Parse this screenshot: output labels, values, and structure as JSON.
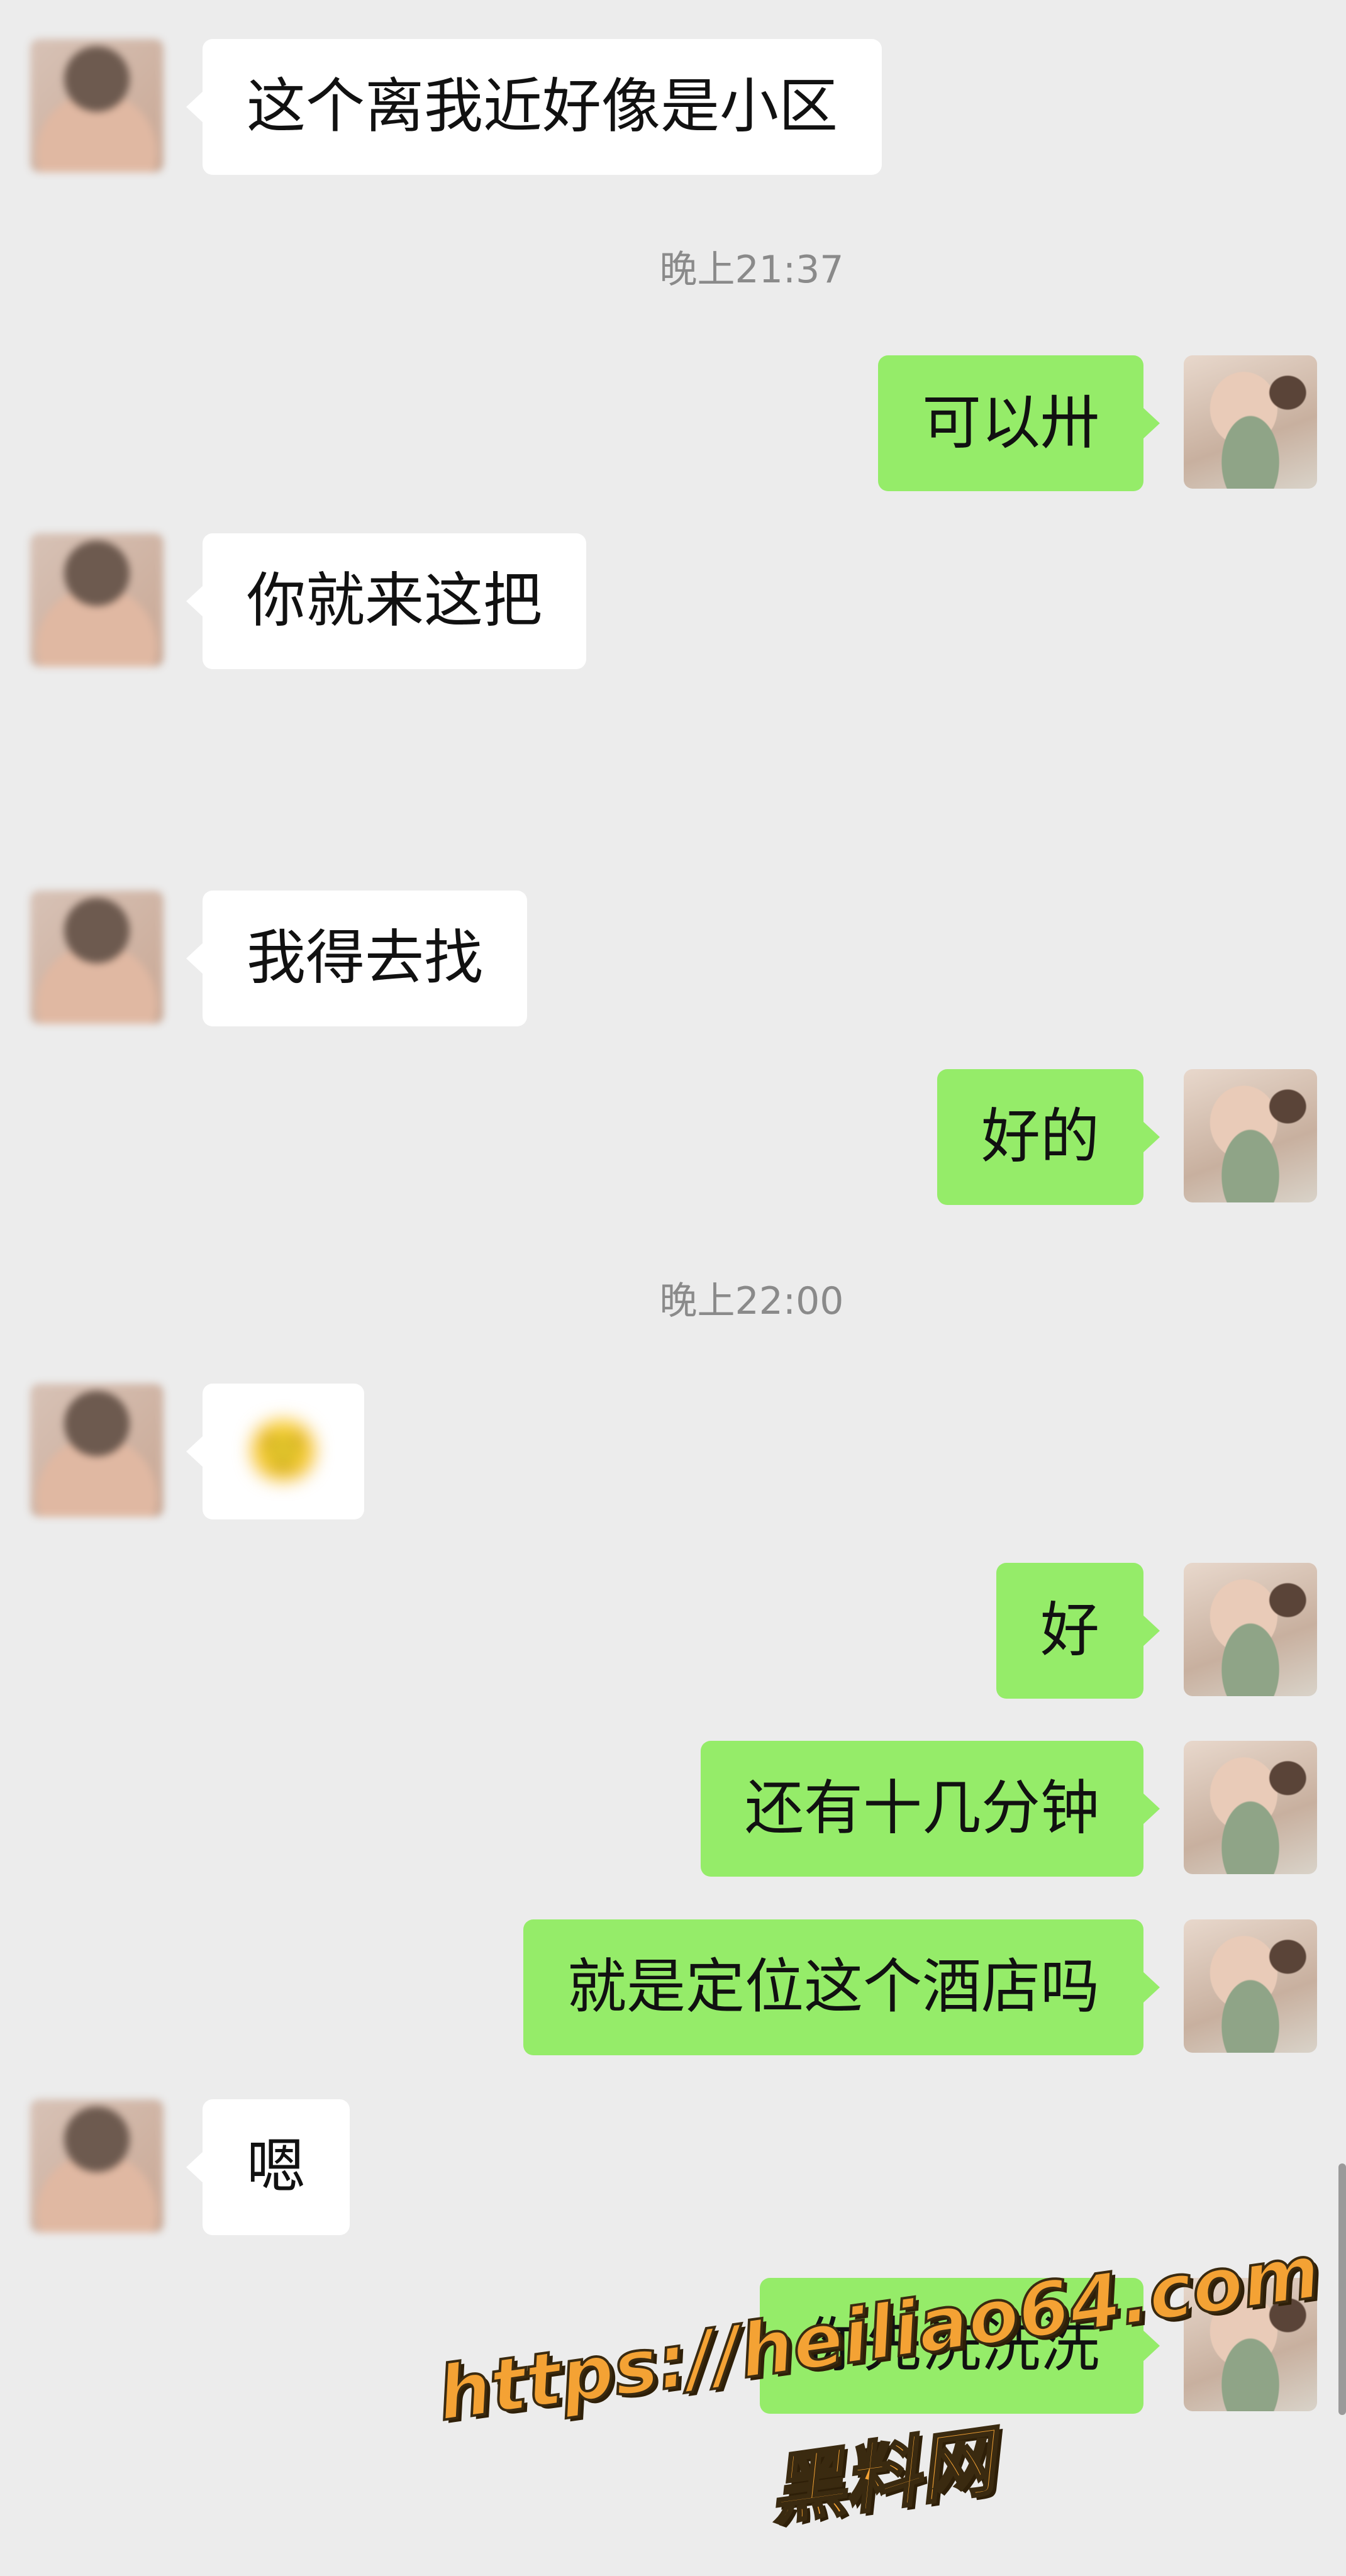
{
  "timestamps": [
    "晚上21:37",
    "晚上22:00"
  ],
  "messages": [
    {
      "side": "in",
      "text": "这个离我近好像是小区"
    },
    {
      "side": "out",
      "text": "可以卅"
    },
    {
      "side": "in",
      "text": "你就来这把"
    },
    {
      "side": "in",
      "text": "我得去找"
    },
    {
      "side": "out",
      "text": "好的"
    },
    {
      "side": "in",
      "text": "🙂",
      "blurred": true
    },
    {
      "side": "out",
      "text": "好"
    },
    {
      "side": "out",
      "text": "还有十几分钟"
    },
    {
      "side": "out",
      "text": "就是定位这个酒店吗"
    },
    {
      "side": "in",
      "text": "嗯"
    },
    {
      "side": "out",
      "text": "你先洗洗洗"
    }
  ],
  "watermark": {
    "url": "https://heiliao64.com",
    "name": "黑料网"
  },
  "colors": {
    "background": "#ededed",
    "incoming_bubble": "#ffffff",
    "outgoing_bubble": "#95ec69",
    "timestamp": "#8a8a8a"
  }
}
